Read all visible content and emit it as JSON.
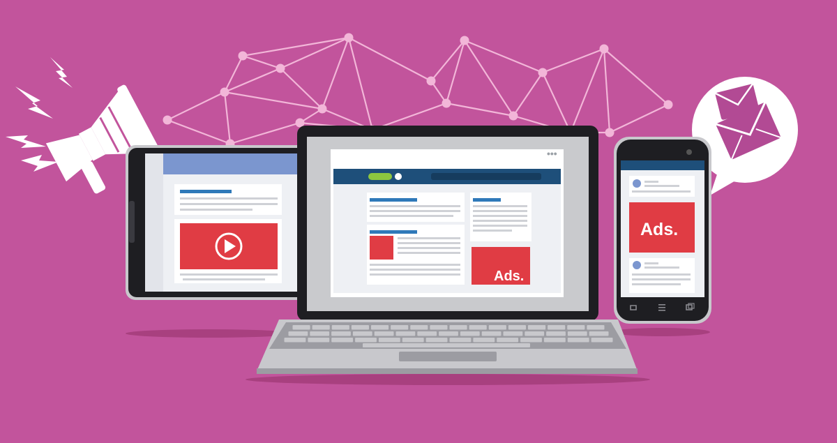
{
  "colors": {
    "background": "#c2549c",
    "network": "#f2b6d8",
    "ad_red": "#e03c44",
    "header_navy": "#1e4f7a",
    "tablet_header": "#7b96cf",
    "accent_blue": "#2f79b9",
    "green_pill": "#8dc63f",
    "device_dark": "#1e1e22",
    "device_silver": "#c8c8cc"
  },
  "laptop": {
    "browser_dots": "•••",
    "ad_label": "Ads."
  },
  "phone": {
    "ad_label": "Ads."
  },
  "tablet": {
    "video_icon": "play-button-icon"
  },
  "icons": {
    "megaphone": "megaphone-icon",
    "mail": "envelope-icon",
    "network": "network-graph-icon"
  }
}
